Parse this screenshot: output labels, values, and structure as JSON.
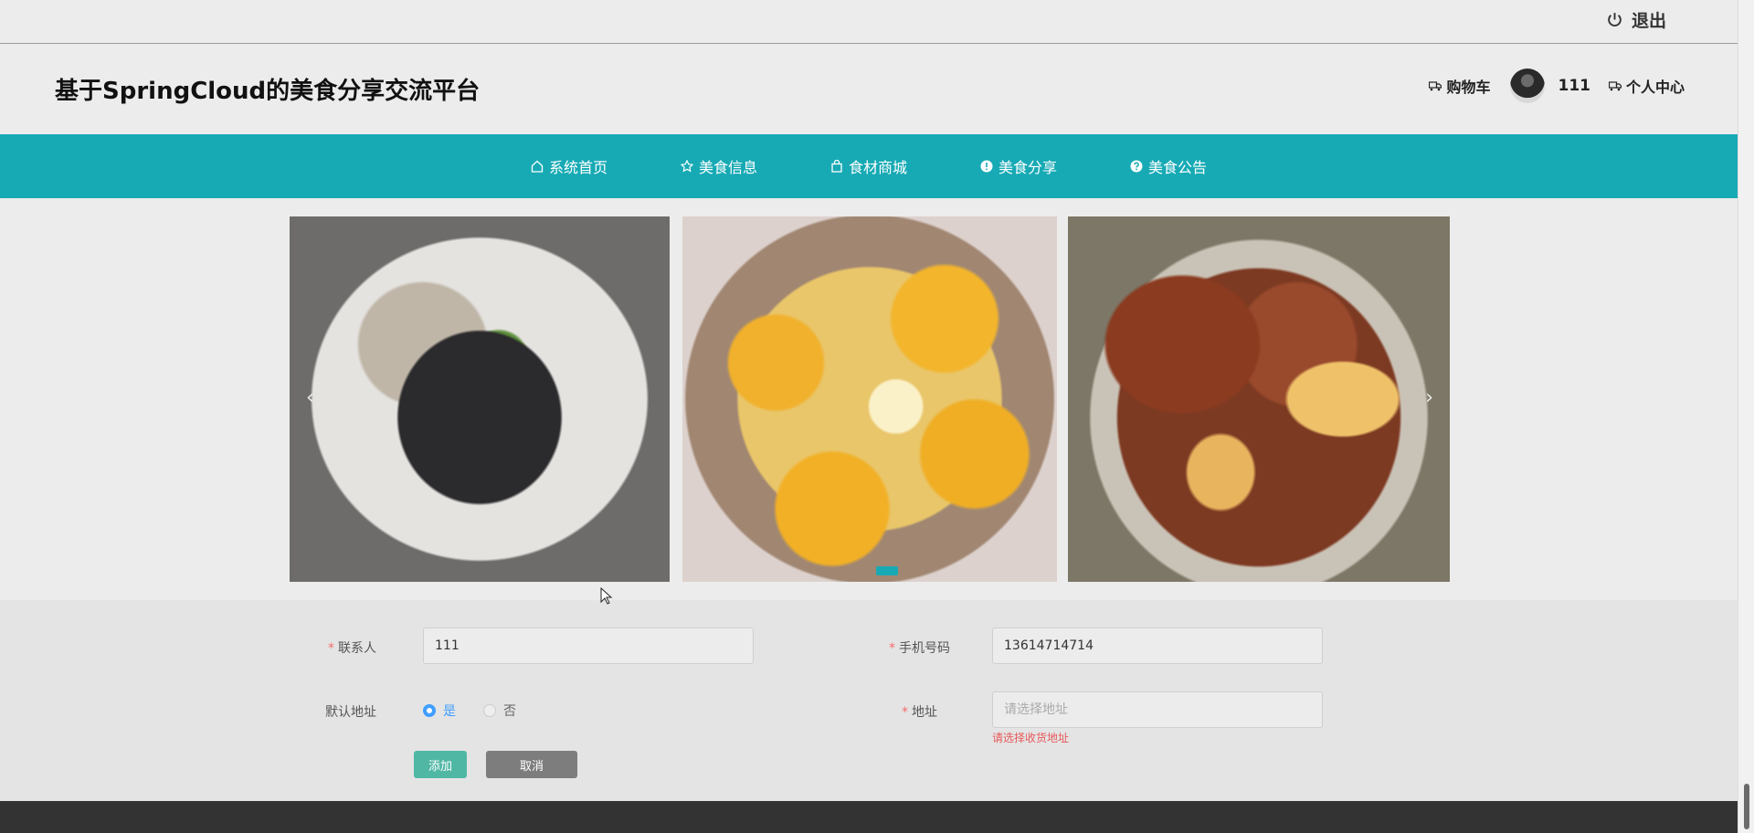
{
  "topbar": {
    "logout_label": "退出"
  },
  "header": {
    "title": "基于SpringCloud的美食分享交流平台",
    "cart_label": "购物车",
    "username": "111",
    "profile_label": "个人中心"
  },
  "nav": {
    "items": [
      {
        "label": "系统首页",
        "icon": "home-icon"
      },
      {
        "label": "美食信息",
        "icon": "star-icon"
      },
      {
        "label": "食材商城",
        "icon": "bag-icon"
      },
      {
        "label": "美食分享",
        "icon": "info-circle-icon"
      },
      {
        "label": "美食公告",
        "icon": "question-circle-icon"
      }
    ]
  },
  "carousel": {
    "prev": "‹",
    "next": "›"
  },
  "form": {
    "contact_label": "联系人",
    "contact_value": "111",
    "phone_label": "手机号码",
    "phone_value": "13614714714",
    "default_label": "默认地址",
    "yes_label": "是",
    "no_label": "否",
    "address_label": "地址",
    "address_placeholder": "请选择地址",
    "address_error": "请选择收货地址",
    "add_button": "添加",
    "cancel_button": "取消"
  },
  "colors": {
    "accent": "#17aab5",
    "add_button": "#50b7a5",
    "cancel_button": "#7d7d7d",
    "error": "#e8585a",
    "radio_active": "#409eff"
  }
}
